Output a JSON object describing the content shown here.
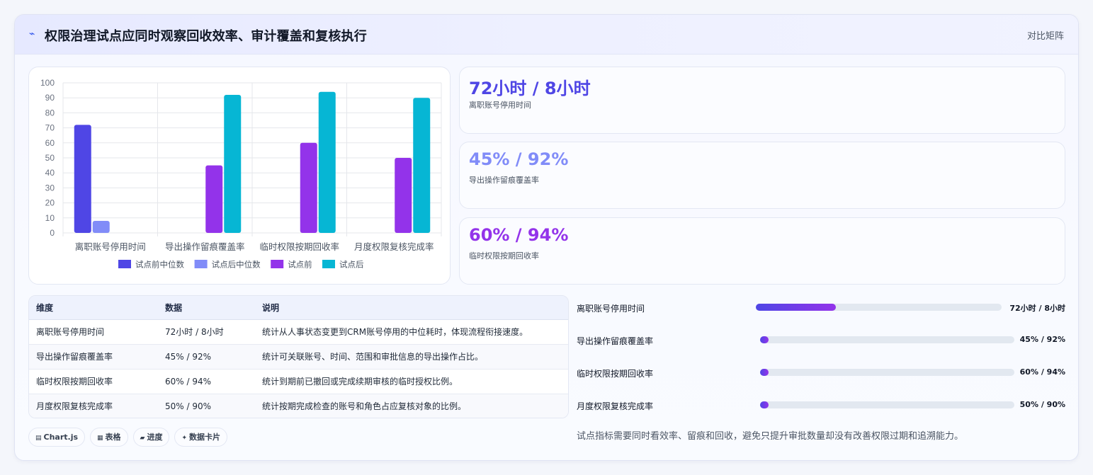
{
  "header": {
    "icon": "pulse-icon",
    "title": "权限治理试点应同时观察回收效率、审计覆盖和复核执行",
    "badge": "对比矩阵"
  },
  "chart_data": {
    "type": "bar",
    "categories": [
      "离职账号停用时间",
      "导出操作留痕覆盖率",
      "临时权限按期回收率",
      "月度权限复核完成率"
    ],
    "series": [
      {
        "name": "试点前中位数",
        "values": [
          72,
          null,
          null,
          null
        ],
        "color": "#4f46e5"
      },
      {
        "name": "试点后中位数",
        "values": [
          8,
          null,
          null,
          null
        ],
        "color": "#818cf8"
      },
      {
        "name": "试点前",
        "values": [
          null,
          45,
          60,
          50
        ],
        "color": "#9333ea"
      },
      {
        "name": "试点后",
        "values": [
          null,
          92,
          94,
          90
        ],
        "color": "#06b6d4"
      }
    ],
    "yticks": [
      "100",
      "90",
      "80",
      "70",
      "60",
      "50",
      "40",
      "30",
      "20",
      "10",
      "0"
    ],
    "ylim": [
      0,
      100
    ],
    "grid": true,
    "legend": "bottom"
  },
  "stats": [
    {
      "value": "72小时 / 8小时",
      "label": "离职账号停用时间",
      "color": "#4f46e5"
    },
    {
      "value": "45% / 92%",
      "label": "导出操作留痕覆盖率",
      "color": "#818cf8"
    },
    {
      "value": "60% / 94%",
      "label": "临时权限按期回收率",
      "color": "#9333ea"
    }
  ],
  "table": {
    "headers": [
      "维度",
      "数据",
      "说明"
    ],
    "rows": [
      [
        "离职账号停用时间",
        "72小时 / 8小时",
        "统计从人事状态变更到CRM账号停用的中位耗时，体现流程衔接速度。"
      ],
      [
        "导出操作留痕覆盖率",
        "45% / 92%",
        "统计可关联账号、时间、范围和审批信息的导出操作占比。"
      ],
      [
        "临时权限按期回收率",
        "60% / 94%",
        "统计到期前已撤回或完成续期审核的临时授权比例。"
      ],
      [
        "月度权限复核完成率",
        "50% / 90%",
        "统计按期完成检查的账号和角色占应复核对象的比例。"
      ]
    ]
  },
  "chips": [
    {
      "icon": "▤",
      "label": "Chart.js"
    },
    {
      "icon": "▦",
      "label": "表格"
    },
    {
      "icon": "▰",
      "label": "进度"
    },
    {
      "icon": "✦",
      "label": "数据卡片"
    }
  ],
  "progress": [
    {
      "label": "离职账号停用时间",
      "value": "72小时 / 8小时",
      "fraction": 0.325
    },
    {
      "label": "导出操作留痕覆盖率",
      "value": "45% / 92%",
      "fraction": 0.03
    },
    {
      "label": "临时权限按期回收率",
      "value": "60% / 94%",
      "fraction": 0.03
    },
    {
      "label": "月度权限复核完成率",
      "value": "50% / 90%",
      "fraction": 0.03
    }
  ],
  "note": "试点指标需要同时看效率、留痕和回收，避免只提升审批数量却没有改善权限过期和追溯能力。"
}
